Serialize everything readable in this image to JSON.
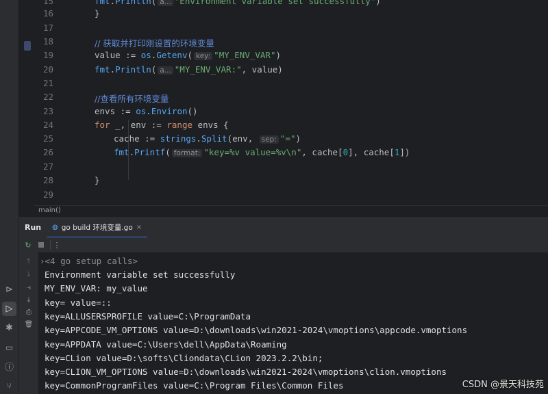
{
  "editor": {
    "lines": [
      {
        "no": "15",
        "text": "fmt.Println(\"Environment variable set successfully\")"
      },
      {
        "no": "16",
        "text": "}"
      },
      {
        "no": "17",
        "text": ""
      },
      {
        "no": "18",
        "text": "// 获取并打印刚设置的环境变量"
      },
      {
        "no": "19",
        "text": "value := os.Getenv(\"MY_ENV_VAR\")"
      },
      {
        "no": "20",
        "text": "fmt.Println(\"MY_ENV_VAR:\", value)"
      },
      {
        "no": "21",
        "text": ""
      },
      {
        "no": "22",
        "text": "//查看所有环境变量"
      },
      {
        "no": "23",
        "text": "envs := os.Environ()"
      },
      {
        "no": "24",
        "text": "for _, env := range envs {"
      },
      {
        "no": "25",
        "text": "cache := strings.Split(env, \"=\")"
      },
      {
        "no": "26",
        "text": "fmt.Printf(\"key=%v value=%v\\n\", cache[0], cache[1])"
      },
      {
        "no": "27",
        "text": ""
      },
      {
        "no": "28",
        "text": "}"
      },
      {
        "no": "29",
        "text": ""
      }
    ],
    "hints": {
      "a": "a...",
      "key": "key:",
      "sep": "sep:",
      "format": "format:"
    }
  },
  "breadcrumb": "main()",
  "run": {
    "title": "Run",
    "tab_label": "go build 环境变量.go",
    "tab_close": "×"
  },
  "console": {
    "lines": [
      "<4 go setup calls>",
      "Environment variable set successfully",
      "MY_ENV_VAR: my_value",
      "key= value=::",
      "key=ALLUSERSPROFILE value=C:\\ProgramData",
      "key=APPCODE_VM_OPTIONS value=D:\\downloads\\win2021-2024\\vmoptions\\appcode.vmoptions",
      "key=APPDATA value=C:\\Users\\dell\\AppData\\Roaming",
      "key=CLion value=D:\\softs\\Cliondata\\CLion 2023.2.2\\bin;",
      "key=CLION_VM_OPTIONS value=D:\\downloads\\win2021-2024\\vmoptions\\clion.vmoptions",
      "key=CommonProgramFiles value=C:\\Program Files\\Common Files"
    ]
  },
  "watermark": "CSDN @景天科技苑",
  "icons": {
    "left_strip": [
      "services-icon",
      "run-icon",
      "debug-icon",
      "terminal-icon",
      "problems-icon",
      "git-icon"
    ],
    "run_toolbar": [
      "rerun-icon",
      "stop-icon",
      "more-icon"
    ],
    "console_side": [
      "up-arrow-icon",
      "down-arrow-icon",
      "soft-wrap-icon",
      "scroll-to-end-icon",
      "print-icon",
      "trash-icon"
    ]
  },
  "colors": {
    "background": "#1e1f22",
    "panel": "#2b2d30",
    "keyword": "#cf8e6d",
    "string": "#6aab73",
    "function": "#56a8f5",
    "comment": "#5f8ad6",
    "number": "#2aacb8",
    "accent": "#3574f0"
  }
}
